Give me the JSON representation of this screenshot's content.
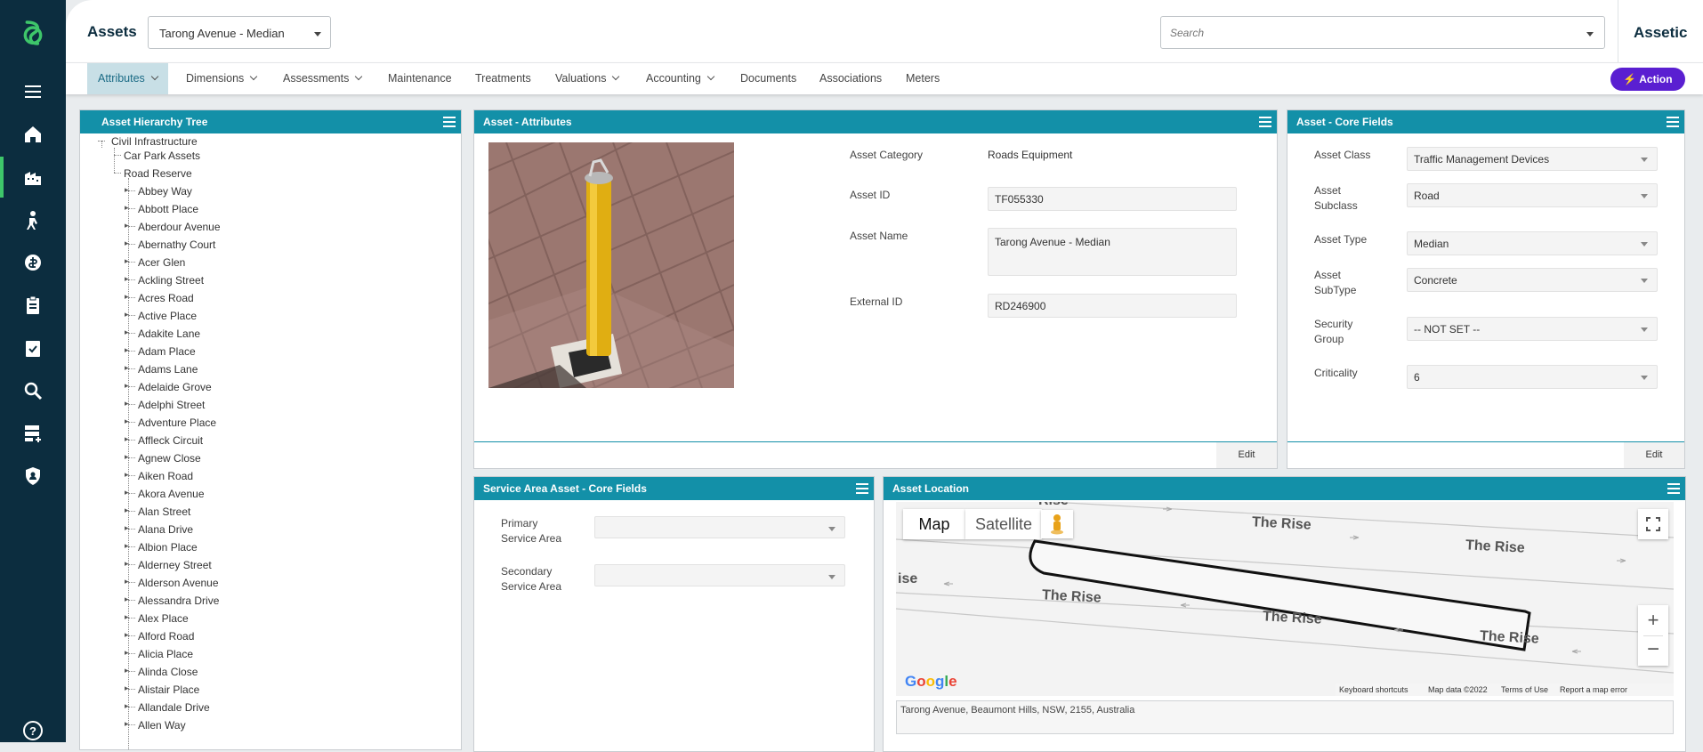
{
  "app": {
    "title": "Assets",
    "brand": "Assetic"
  },
  "asset_selector": {
    "value": "Tarong Avenue - Median"
  },
  "search": {
    "placeholder": "Search"
  },
  "nav_icons": [
    "menu-icon",
    "home-icon",
    "building-icon",
    "worker-icon",
    "budget-icon",
    "clipboard-icon",
    "task-icon",
    "search-icon",
    "forms-icon",
    "shield-icon",
    "help-icon"
  ],
  "tabs": [
    {
      "label": "Attributes",
      "has_menu": true,
      "active": true
    },
    {
      "label": "Dimensions",
      "has_menu": true
    },
    {
      "label": "Assessments",
      "has_menu": true
    },
    {
      "label": "Maintenance"
    },
    {
      "label": "Treatments"
    },
    {
      "label": "Valuations",
      "has_menu": true
    },
    {
      "label": "Accounting",
      "has_menu": true
    },
    {
      "label": "Documents"
    },
    {
      "label": "Associations"
    },
    {
      "label": "Meters"
    }
  ],
  "action_button": {
    "label": "Action"
  },
  "hierarchy": {
    "title": "Asset Hierarchy Tree",
    "root": "Civil Infrastructure",
    "level1": [
      "Car Park Assets",
      "Road Reserve"
    ],
    "roads": [
      "Abbey Way",
      "Abbott Place",
      "Aberdour Avenue",
      "Abernathy Court",
      "Acer Glen",
      "Ackling Street",
      "Acres Road",
      "Active Place",
      "Adakite Lane",
      "Adam Place",
      "Adams Lane",
      "Adelaide Grove",
      "Adelphi Street",
      "Adventure Place",
      "Affleck Circuit",
      "Agnew Close",
      "Aiken Road",
      "Akora Avenue",
      "Alan Street",
      "Alana Drive",
      "Albion Place",
      "Alderney Street",
      "Alderson Avenue",
      "Alessandra Drive",
      "Alex Place",
      "Alford Road",
      "Alicia Place",
      "Alinda Close",
      "Alistair Place",
      "Allandale Drive",
      "Allen Way"
    ]
  },
  "attributes": {
    "title": "Asset - Attributes",
    "category_label": "Asset Category",
    "category_value": "Roads Equipment",
    "id_label": "Asset ID",
    "id_value": "TF055330",
    "name_label": "Asset Name",
    "name_value": "Tarong Avenue - Median",
    "external_label": "External ID",
    "external_value": "RD246900",
    "edit": "Edit"
  },
  "core_fields": {
    "title": "Asset - Core Fields",
    "rows": [
      {
        "label1": "Asset Class",
        "label2": "",
        "value": "Traffic Management Devices"
      },
      {
        "label1": "Asset",
        "label2": "Subclass",
        "value": "Road"
      },
      {
        "label1": "Asset Type",
        "label2": "",
        "value": "Median"
      },
      {
        "label1": "Asset",
        "label2": "SubType",
        "value": "Concrete"
      },
      {
        "label1": "Security",
        "label2": "Group",
        "value": "-- NOT SET --"
      },
      {
        "label1": "Criticality",
        "label2": "",
        "value": "6"
      }
    ],
    "edit": "Edit"
  },
  "service_area": {
    "title": "Service Area Asset - Core Fields",
    "primary_l1": "Primary",
    "primary_l2": "Service Area",
    "secondary_l1": "Secondary",
    "secondary_l2": "Service Area"
  },
  "location": {
    "title": "Asset Location",
    "map_tab": "Map",
    "satellite_tab": "Satellite",
    "road_labels": [
      "The Rise",
      "The Rise",
      "The Rise",
      "The Rise",
      "The Rise",
      "ise",
      "Rise"
    ],
    "google": "Google",
    "keyboard": "Keyboard shortcuts",
    "mapdata": "Map data ©2022",
    "terms": "Terms of Use",
    "report": "Report a map error",
    "address": "Tarong Avenue, Beaumont Hills, NSW, 2155, Australia"
  }
}
